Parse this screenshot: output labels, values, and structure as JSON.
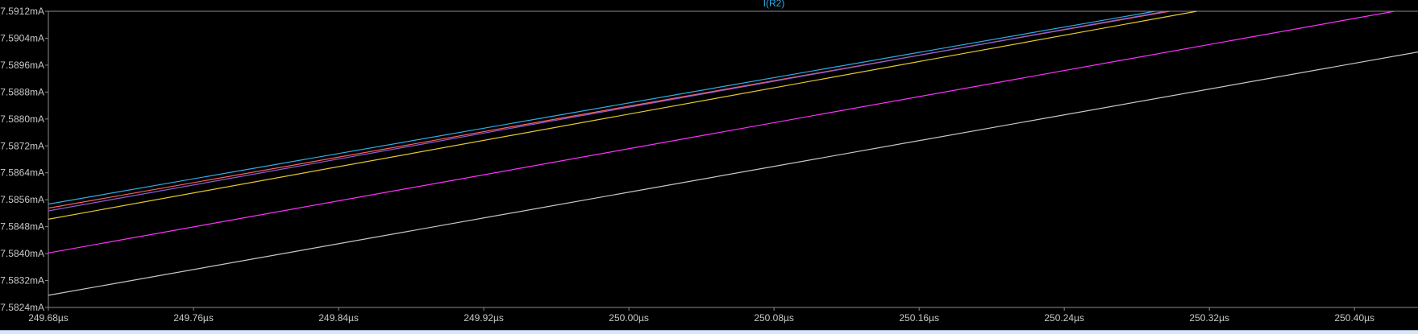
{
  "colors": {
    "background": "#000000",
    "frame": "#8c8c8c",
    "text": "#c8c8c8",
    "title": "#2eaee6",
    "bottom_strip": "#dbe6f4"
  },
  "chart_data": {
    "type": "line",
    "title": "I(R2)",
    "xlabel": "",
    "ylabel": "",
    "xlim": [
      249.68,
      250.435
    ],
    "ylim": [
      7.5824,
      7.5912
    ],
    "x_unit": "µs",
    "y_unit": "mA",
    "grid": false,
    "x_ticks": [
      "249.68µs",
      "249.76µs",
      "249.84µs",
      "249.92µs",
      "250.00µs",
      "250.08µs",
      "250.16µs",
      "250.24µs",
      "250.32µs",
      "250.40µs"
    ],
    "x_tick_values": [
      249.68,
      249.76,
      249.84,
      249.92,
      250.0,
      250.08,
      250.16,
      250.24,
      250.32,
      250.4
    ],
    "y_ticks": [
      "7.5912mA",
      "7.5904mA",
      "7.5896mA",
      "7.5888mA",
      "7.5880mA",
      "7.5872mA",
      "7.5864mA",
      "7.5856mA",
      "7.5848mA",
      "7.5840mA",
      "7.5832mA",
      "7.5824mA"
    ],
    "y_tick_values": [
      7.5912,
      7.5904,
      7.5896,
      7.5888,
      7.588,
      7.5872,
      7.5864,
      7.5856,
      7.5848,
      7.584,
      7.5832,
      7.5824
    ],
    "series": [
      {
        "color": "#2eaee6",
        "x": [
          249.68,
          250.29
        ],
        "y": [
          7.58547,
          7.5912
        ]
      },
      {
        "color": "#ff6060",
        "x": [
          249.68,
          250.298
        ],
        "y": [
          7.58535,
          7.5912
        ]
      },
      {
        "color": "#8c5fd6",
        "x": [
          249.68,
          250.296
        ],
        "y": [
          7.58527,
          7.5912
        ]
      },
      {
        "color": "#e6c832",
        "x": [
          249.68,
          250.313
        ],
        "y": [
          7.58502,
          7.5912
        ]
      },
      {
        "color": "#ff30ff",
        "x": [
          249.68,
          250.422
        ],
        "y": [
          7.58402,
          7.5912
        ]
      },
      {
        "color": "#c8c8c8",
        "x": [
          249.68,
          250.435
        ],
        "y": [
          7.58276,
          7.58999
        ]
      }
    ]
  }
}
